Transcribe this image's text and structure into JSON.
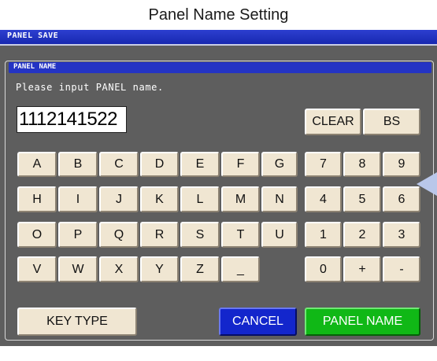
{
  "caption": "Panel Name Setting",
  "screen": {
    "top_bar_title": "PANEL SAVE",
    "panel_title": "PANEL NAME",
    "prompt": "Please input PANEL name.",
    "input_value": "1112141522"
  },
  "keys": {
    "clear": "CLEAR",
    "bs": "BS",
    "letters": [
      "A",
      "B",
      "C",
      "D",
      "E",
      "F",
      "G",
      "H",
      "I",
      "J",
      "K",
      "L",
      "M",
      "N",
      "O",
      "P",
      "Q",
      "R",
      "S",
      "T",
      "U",
      "V",
      "W",
      "X",
      "Y",
      "Z",
      "_"
    ],
    "digits": [
      "7",
      "8",
      "9",
      "4",
      "5",
      "6",
      "1",
      "2",
      "3",
      "0",
      "+",
      "-"
    ],
    "key_type": "KEY TYPE",
    "cancel": "CANCEL",
    "confirm": "PANEL NAME"
  },
  "colors": {
    "screen_bg": "#5e5e5e",
    "title_bar": "#1f31c0",
    "key_face": "#f0e6d2",
    "cancel": "#1326cc",
    "confirm": "#10b816",
    "callout_arrow": "#b9c7ea"
  }
}
